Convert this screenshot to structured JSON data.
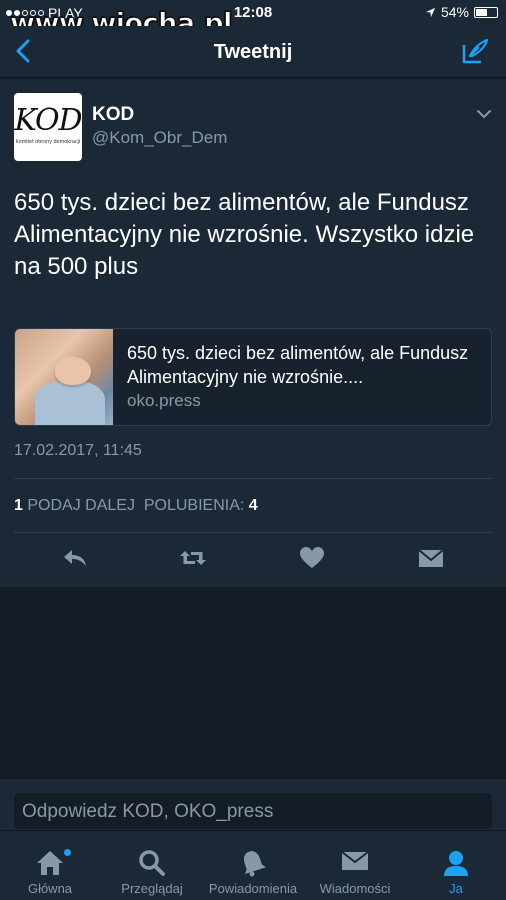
{
  "status_bar": {
    "carrier": "PLAY",
    "time": "12:08",
    "battery_percent": "54%",
    "battery_level": 0.54
  },
  "watermark": "www.wiocha.pl",
  "nav": {
    "title": "Tweetnij",
    "back_icon": "chevron-left-icon",
    "compose_icon": "compose-icon"
  },
  "tweet": {
    "avatar_logo": "KOD",
    "avatar_sub": "komitet obrony demokracji",
    "name": "KOD",
    "handle": "@Kom_Obr_Dem",
    "text": "650 tys. dzieci bez alimentów, ale Fundusz Alimentacyjny nie wzrośnie. Wszystko idzie na 500 plus",
    "card": {
      "title": "650 tys. dzieci bez alimentów, ale Fundusz Alimentacyjny nie wzrośnie....",
      "domain": "oko.press"
    },
    "timestamp": "17.02.2017, 11:45",
    "retweets_count": "1",
    "retweets_label": "PODAJ DALEJ",
    "likes_label": "POLUBIENIA:",
    "likes_count": "4"
  },
  "reply": {
    "placeholder": "Odpowiedz KOD, OKO_press"
  },
  "tabs": [
    {
      "label": "Główna",
      "icon": "home-icon"
    },
    {
      "label": "Przeglądaj",
      "icon": "search-icon"
    },
    {
      "label": "Powiadomienia",
      "icon": "bell-icon"
    },
    {
      "label": "Wiadomości",
      "icon": "envelope-icon"
    },
    {
      "label": "Ja",
      "icon": "person-icon"
    }
  ],
  "colors": {
    "background": "#141d26",
    "card": "#1b2836",
    "accent": "#1da1f2",
    "muted": "#8899a6"
  }
}
